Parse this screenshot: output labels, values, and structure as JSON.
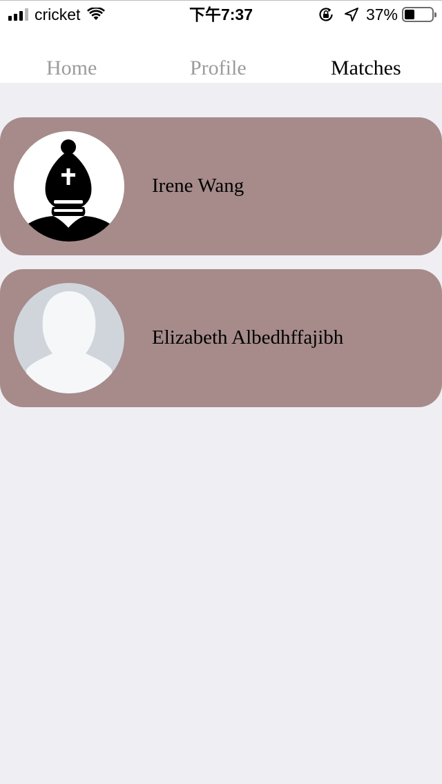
{
  "status_bar": {
    "carrier": "cricket",
    "time": "下午7:37",
    "battery_percent": "37%",
    "battery_level": 0.37,
    "signal_bars_active": 3,
    "signal_bars_total": 4,
    "icons": [
      "signal-icon",
      "wifi-icon",
      "orientation-lock-icon",
      "location-arrow-icon",
      "battery-icon"
    ]
  },
  "tabs": [
    {
      "label": "Home",
      "active": false
    },
    {
      "label": "Profile",
      "active": false
    },
    {
      "label": "Matches",
      "active": true
    }
  ],
  "colors": {
    "card_background": "#a68b8a",
    "page_background": "#efeef3",
    "tab_inactive": "#9b9b9b",
    "tab_active": "#000000"
  },
  "matches": [
    {
      "name": "Irene Wang",
      "avatar": "chess-bishop-icon"
    },
    {
      "name": "Elizabeth Albedhffajibh",
      "avatar": "default-person-silhouette"
    }
  ]
}
